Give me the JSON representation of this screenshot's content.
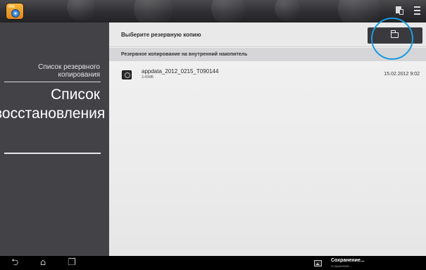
{
  "left_panel": {
    "items": [
      {
        "label": "Список резервного копирования"
      },
      {
        "label": "Список восстановления"
      }
    ]
  },
  "main": {
    "title": "Выберите резервную копию",
    "section_label": "Резервное копирование на внутренний накопитель",
    "files": [
      {
        "name": "appdata_2012_0215_T090144",
        "size": "3,45МБ",
        "date": "15.02.2012 9:02"
      }
    ]
  },
  "notification": {
    "title": "Сохранение...",
    "subtitle": "Сохранение..."
  },
  "icons": {
    "app": "backup-app-icon",
    "folder": "folder-icon",
    "file": "app-data-file-icon"
  },
  "colors": {
    "panel": "#434247",
    "highlight_ring": "#1a9be0",
    "main_bg": "#ececec"
  }
}
